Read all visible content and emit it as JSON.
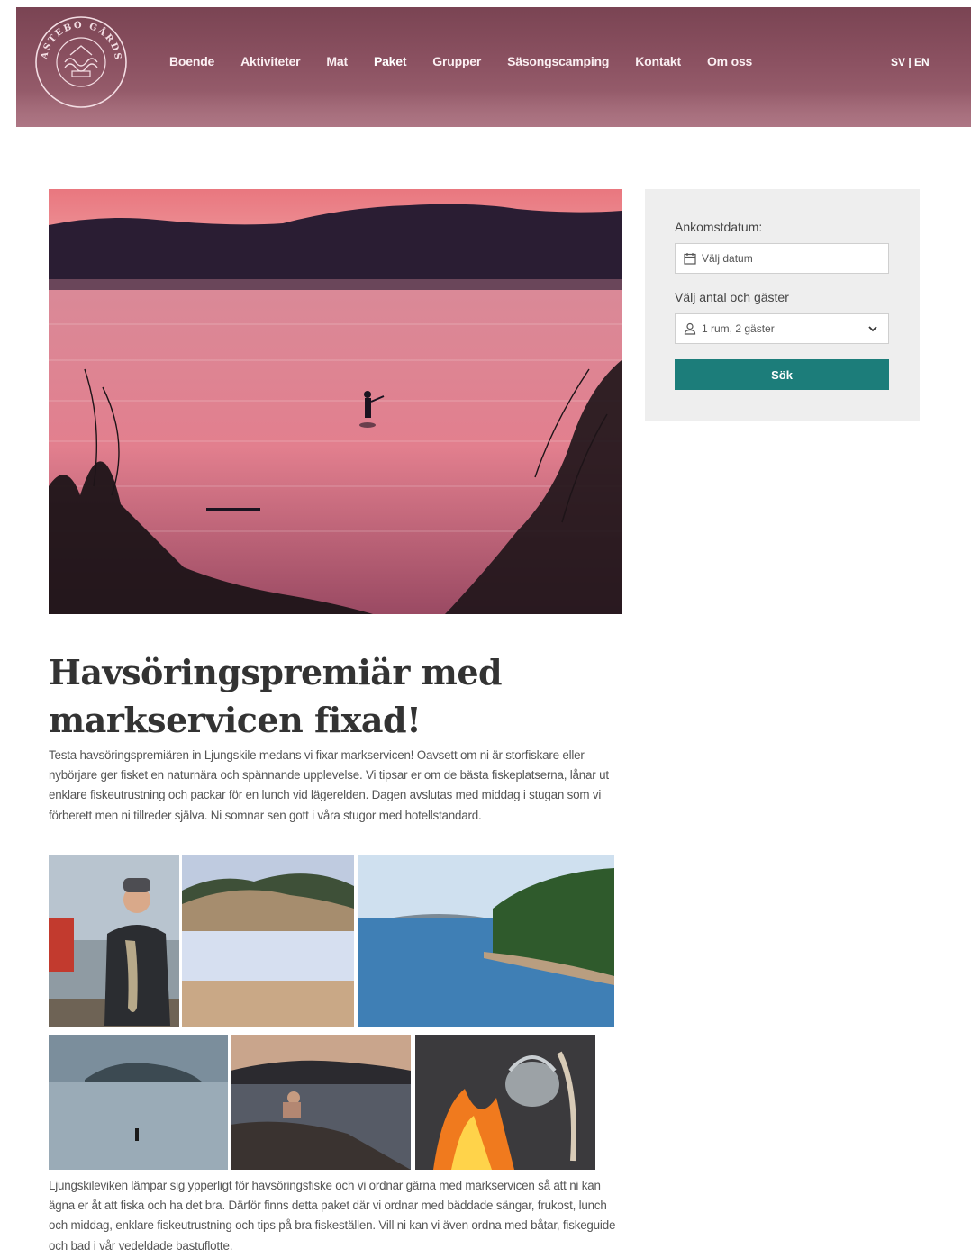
{
  "header": {
    "logo_text": "ANFASTEBO GÅRDSVIK",
    "nav": [
      {
        "label": "Boende"
      },
      {
        "label": "Aktiviteter"
      },
      {
        "label": "Mat"
      },
      {
        "label": "Paket",
        "active": true
      },
      {
        "label": "Grupper"
      },
      {
        "label": "Säsongscamping"
      },
      {
        "label": "Kontakt"
      },
      {
        "label": "Om oss"
      }
    ],
    "lang": "SV | EN",
    "bg_color": "#8b5161"
  },
  "booking": {
    "arrival_label": "Ankomstdatum:",
    "date_placeholder": "Välj datum",
    "guests_label": "Välj antal och gäster",
    "guests_value": "1 rum, 2 gäster",
    "search_button": "Sök",
    "button_color": "#1c7d7a"
  },
  "article": {
    "title": "Havsöringspremiär med markservicen fixad!",
    "intro": "Testa havsöringspremiären in Ljungskile medans vi fixar markservicen! Oavsett om ni är storfiskare eller nybörjare ger fisket en naturnära och spännande upplevelse. Vi tipsar er om de bästa fiskeplatserna, lånar ut enklare fiskeutrustning och packar för en lunch vid lägerelden. Dagen avslutas med middag i stugan som vi förberett men ni tillreder själva. Ni somnar sen gott i våra stugor med hotellstandard.",
    "body": "Ljungskileviken lämpar sig ypperligt för havsöringsfiske och vi ordnar gärna med markservicen så att ni kan ägna er åt att fiska och ha det bra. Därför finns detta paket där vi ordnar med bäddade sängar, frukost, lunch och middag, enklare fiskeutrustning och tips på bra fiskeställen. Vill ni kan vi även ordna med båtar, fiskeguide och bad i vår vedeldade bastuflotte."
  }
}
